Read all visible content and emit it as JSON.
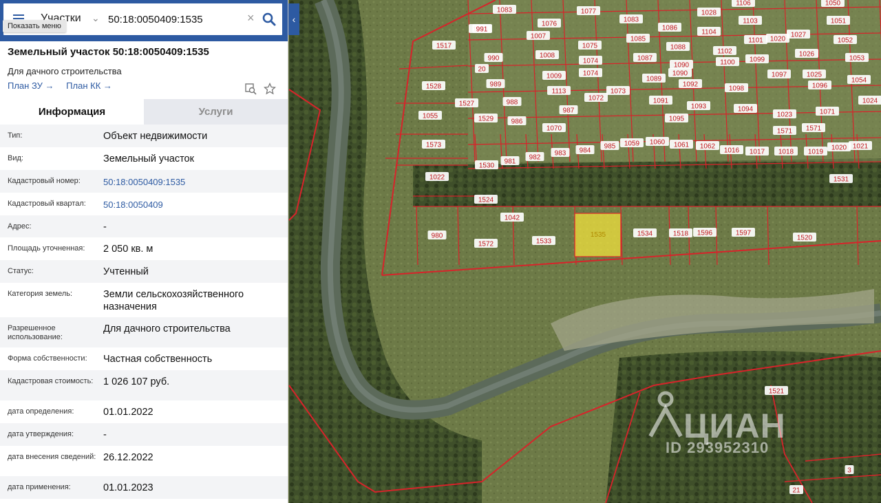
{
  "search": {
    "menu_label": "Показать меню",
    "layer": "Участки",
    "query": "50:18:0050409:1535",
    "clear_icon": "close-icon",
    "search_icon": "search-icon"
  },
  "header": {
    "title": "Земельный участок 50:18:0050409:1535",
    "subtitle": "Для дачного строительства",
    "link_plan_zu": "План ЗУ",
    "link_plan_kk": "План КК"
  },
  "tabs": {
    "info": "Информация",
    "services": "Услуги"
  },
  "details": [
    {
      "label": "Тип:",
      "value": "Объект недвижимости",
      "h": 33
    },
    {
      "label": "Вид:",
      "value": "Земельный участок",
      "h": 33
    },
    {
      "label": "Кадастровый номер:",
      "value": "50:18:0050409:1535",
      "h": 33,
      "link": true
    },
    {
      "label": "Кадастровый квартал:",
      "value": "50:18:0050409",
      "h": 33,
      "link": true
    },
    {
      "label": "Адрес:",
      "value": "-",
      "h": 32
    },
    {
      "label": "Площадь уточненная:",
      "value": "2 050 кв. м",
      "h": 33
    },
    {
      "label": "Статус:",
      "value": "Учтенный",
      "h": 33
    },
    {
      "label": "Категория земель:",
      "value": "Земли сельскохозяйственного назначения",
      "h": 50
    },
    {
      "label": "Разрешенное использование:",
      "value": "Для дачного строительства",
      "h": 44
    },
    {
      "label": "Форма собственности:",
      "value": "Частная собственность",
      "h": 33
    },
    {
      "label": "Кадастровая стоимость:",
      "value": "1 026 107 руб.",
      "h": 44
    },
    {
      "label": "дата определения:",
      "value": "01.01.2022",
      "h": 33
    },
    {
      "label": "дата утверждения:",
      "value": "-",
      "h": 33
    },
    {
      "label": "дата внесения сведений:",
      "value": "26.12.2022",
      "h": 44
    },
    {
      "label": "дата применения:",
      "value": "01.01.2023",
      "h": 33
    }
  ],
  "colors": {
    "brand": "#2d5aa2",
    "parcel_border": "#d8232a",
    "selected_parcel": "#f2e23c"
  },
  "map": {
    "selected_label": "1535",
    "parcel_labels": [
      "1083",
      "1084",
      "1106",
      "1028",
      "1050",
      "991",
      "1076",
      "1077",
      "1007",
      "1083",
      "1086",
      "1104",
      "1103",
      "1020",
      "1027",
      "1051",
      "1517",
      "1075",
      "1085",
      "1088",
      "1102",
      "1101",
      "1052",
      "990",
      "1008",
      "1074",
      "1087",
      "1090",
      "1100",
      "1099",
      "1026",
      "1053",
      "989",
      "1009",
      "1074",
      "1089",
      "1090",
      "1097",
      "1025",
      "1054",
      "1528",
      "988",
      "1113",
      "1072",
      "1073",
      "1092",
      "1098",
      "1096",
      "1024",
      "1527",
      "1091",
      "1093",
      "1094",
      "1055",
      "1529",
      "986",
      "987",
      "1071",
      "1023",
      "1095",
      "1571",
      "1571",
      "1070",
      "1573",
      "1530",
      "981",
      "982",
      "983",
      "984",
      "985",
      "1059",
      "1060",
      "1061",
      "1062",
      "1016",
      "1017",
      "1018",
      "1019",
      "1020",
      "1021",
      "1022",
      "1531",
      "1524",
      "1042",
      "980",
      "1572",
      "1533",
      "1534",
      "1518",
      "1596",
      "1597",
      "1520",
      "1521",
      "3",
      "21",
      "20"
    ],
    "watermark_brand": "ЦИАН",
    "watermark_id": "ID 293952310"
  }
}
